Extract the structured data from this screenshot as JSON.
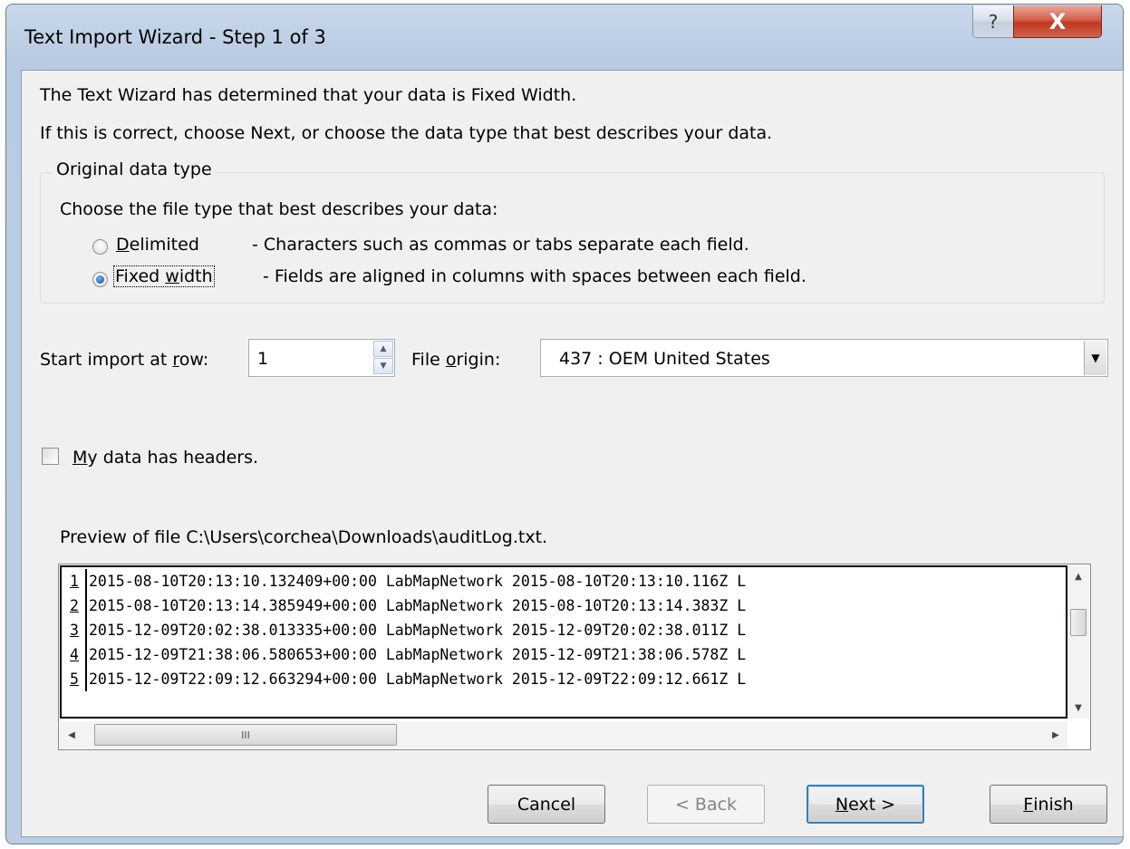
{
  "window": {
    "title": "Text Import Wizard - Step 1 of 3",
    "help_glyph": "?",
    "close_glyph": "X"
  },
  "intro": {
    "line1": "The Text Wizard has determined that your data is Fixed Width.",
    "line2": "If this is correct, choose Next, or choose the data type that best describes your data."
  },
  "original_data_type": {
    "group_label": "Original data type",
    "choose_label": "Choose the file type that best describes your data:",
    "options": [
      {
        "key": "D",
        "rest": "elimited",
        "description": "- Characters such as commas or tabs separate each field.",
        "selected": false
      },
      {
        "pre": "Fixed ",
        "key": "w",
        "rest": "idth",
        "description": "- Fields are aligned in columns with spaces between each field.",
        "selected": true
      }
    ]
  },
  "start_row": {
    "label_pre": "Start import at ",
    "label_key": "r",
    "label_post": "ow:",
    "value": "1"
  },
  "file_origin": {
    "label_pre": "File ",
    "label_key": "o",
    "label_post": "rigin:",
    "value": "437 : OEM United States"
  },
  "headers_checkbox": {
    "key": "M",
    "rest": "y data has headers.",
    "checked": false
  },
  "preview": {
    "label": "Preview of file C:\\Users\\corchea\\Downloads\\auditLog.txt.",
    "rows": [
      {
        "n": "1",
        "text": "2015-08-10T20:13:10.132409+00:00 LabMapNetwork 2015-08-10T20:13:10.116Z L"
      },
      {
        "n": "2",
        "text": "2015-08-10T20:13:14.385949+00:00 LabMapNetwork 2015-08-10T20:13:14.383Z L"
      },
      {
        "n": "3",
        "text": "2015-12-09T20:02:38.013335+00:00 LabMapNetwork 2015-12-09T20:02:38.011Z L"
      },
      {
        "n": "4",
        "text": "2015-12-09T21:38:06.580653+00:00 LabMapNetwork 2015-12-09T21:38:06.578Z L"
      },
      {
        "n": "5",
        "text": "2015-12-09T22:09:12.663294+00:00 LabMapNetwork 2015-12-09T22:09:12.661Z L"
      }
    ],
    "scroll_grip": "III"
  },
  "buttons": {
    "cancel": "Cancel",
    "back": "< Back",
    "next_key": "N",
    "next_rest": "ext >",
    "finish_key": "F",
    "finish_rest": "inish"
  }
}
